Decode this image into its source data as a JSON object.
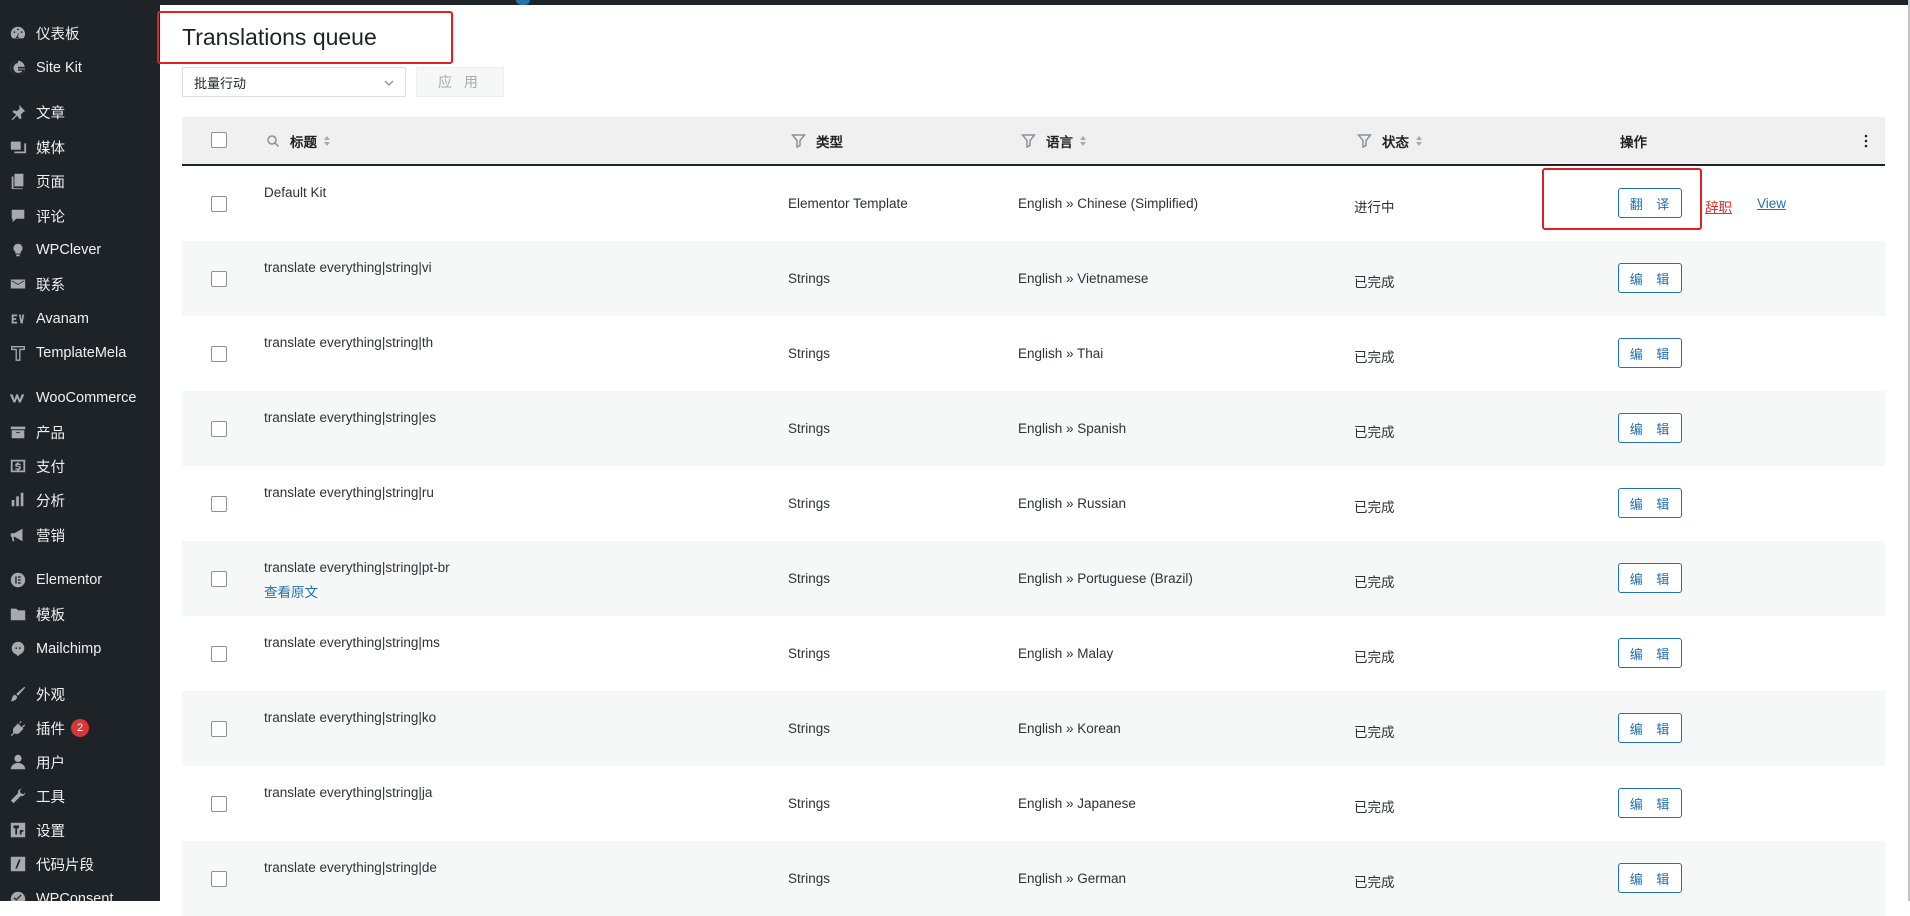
{
  "sidebar": {
    "items": [
      {
        "label": "仪表板",
        "icon": "dashboard-icon"
      },
      {
        "label": "Site Kit",
        "icon": "google-g-icon"
      },
      {
        "label": "文章",
        "icon": "pushpin-icon"
      },
      {
        "label": "媒体",
        "icon": "media-icon"
      },
      {
        "label": "页面",
        "icon": "page-icon"
      },
      {
        "label": "评论",
        "icon": "comment-icon"
      },
      {
        "label": "WPClever",
        "icon": "lightbulb-icon"
      },
      {
        "label": "联系",
        "icon": "mail-icon"
      },
      {
        "label": "Avanam",
        "icon": "avanam-icon"
      },
      {
        "label": "TemplateMela",
        "icon": "templatemela-icon"
      },
      {
        "label": "WooCommerce",
        "icon": "woocommerce-icon"
      },
      {
        "label": "产品",
        "icon": "archive-icon"
      },
      {
        "label": "支付",
        "icon": "dollar-icon"
      },
      {
        "label": "分析",
        "icon": "bar-chart-icon"
      },
      {
        "label": "营销",
        "icon": "megaphone-icon"
      },
      {
        "label": "Elementor",
        "icon": "elementor-icon"
      },
      {
        "label": "模板",
        "icon": "folder-icon"
      },
      {
        "label": "Mailchimp",
        "icon": "mailchimp-icon"
      },
      {
        "label": "外观",
        "icon": "paintbrush-icon"
      },
      {
        "label": "插件",
        "icon": "plugin-icon",
        "badge": "2"
      },
      {
        "label": "用户",
        "icon": "user-icon"
      },
      {
        "label": "工具",
        "icon": "wrench-icon"
      },
      {
        "label": "设置",
        "icon": "settings-icon"
      },
      {
        "label": "代码片段",
        "icon": "code-snippets-icon"
      },
      {
        "label": "WPConsent",
        "icon": "consent-icon"
      }
    ]
  },
  "header": {
    "title": "Translations queue",
    "bulk_action": "批量行动",
    "apply_label": "应 用"
  },
  "table": {
    "columns": {
      "title": "标题",
      "type": "类型",
      "language": "语言",
      "status": "状态",
      "actions": "操作"
    },
    "rows": [
      {
        "title": "Default Kit",
        "type": "Elementor Template",
        "language": "English » Chinese (Simplified)",
        "status": "进行中",
        "action": "翻 译",
        "link1": "辞职",
        "link2": "View"
      },
      {
        "title": "translate everything|string|vi",
        "type": "Strings",
        "language": "English » Vietnamese",
        "status": "已完成",
        "action": "编 辑"
      },
      {
        "title": "translate everything|string|th",
        "type": "Strings",
        "language": "English » Thai",
        "status": "已完成",
        "action": "编 辑"
      },
      {
        "title": "translate everything|string|es",
        "type": "Strings",
        "language": "English » Spanish",
        "status": "已完成",
        "action": "编 辑"
      },
      {
        "title": "translate everything|string|ru",
        "type": "Strings",
        "language": "English » Russian",
        "status": "已完成",
        "action": "编 辑"
      },
      {
        "title": "translate everything|string|pt-br",
        "sub_link": "查看原文",
        "type": "Strings",
        "language": "English » Portuguese (Brazil)",
        "status": "已完成",
        "action": "编 辑"
      },
      {
        "title": "translate everything|string|ms",
        "type": "Strings",
        "language": "English » Malay",
        "status": "已完成",
        "action": "编 辑"
      },
      {
        "title": "translate everything|string|ko",
        "type": "Strings",
        "language": "English » Korean",
        "status": "已完成",
        "action": "编 辑"
      },
      {
        "title": "translate everything|string|ja",
        "type": "Strings",
        "language": "English » Japanese",
        "status": "已完成",
        "action": "编 辑"
      },
      {
        "title": "translate everything|string|de",
        "type": "Strings",
        "language": "English » German",
        "status": "已完成",
        "action": "编 辑"
      }
    ]
  },
  "colors": {
    "sidebar_bg": "#1d2327",
    "accent": "#2271b1",
    "highlight_box": "#e02020",
    "danger_link": "#d63638",
    "badge": "#d63638"
  }
}
